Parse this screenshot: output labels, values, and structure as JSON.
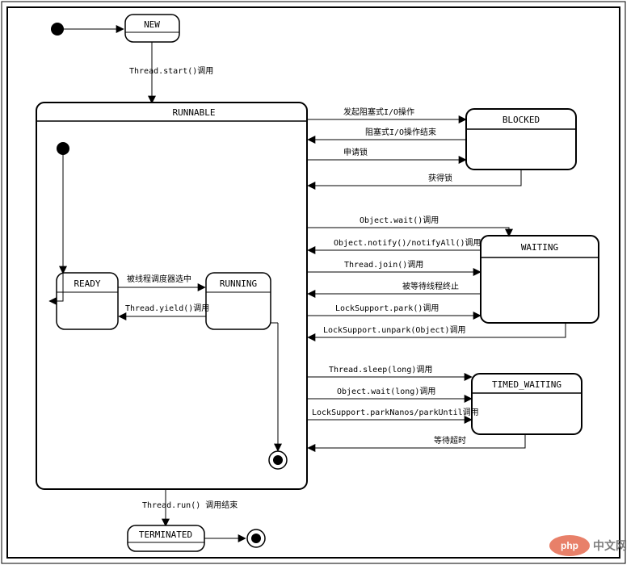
{
  "states": {
    "new": "NEW",
    "runnable": "RUNNABLE",
    "ready": "READY",
    "running": "RUNNING",
    "blocked": "BLOCKED",
    "waiting": "WAITING",
    "timed_waiting": "TIMED_WAITING",
    "terminated": "TERMINATED"
  },
  "edges": {
    "start": "Thread.start()调用",
    "ready_running": "被线程调度器选中",
    "running_ready": "Thread.yield()调用",
    "blk1": "发起阻塞式I/O操作",
    "blk2": "阻塞式I/O操作结束",
    "blk3": "申请锁",
    "blk4": "获得锁",
    "w1": "Object.wait()调用",
    "w2": "Object.notify()/notifyAll()调用",
    "w3": "Thread.join()调用",
    "w4": "被等待线程终止",
    "w5": "LockSupport.park()调用",
    "w6": "LockSupport.unpark(Object)调用",
    "tw1": "Thread.sleep(long)调用",
    "tw2": "Object.wait(long)调用",
    "tw3": "LockSupport.parkNanos/parkUntil调用",
    "tw4": "等待超时",
    "run_end": "Thread.run() 调用结束"
  },
  "watermark": {
    "brand": "php",
    "site": "中文网"
  }
}
